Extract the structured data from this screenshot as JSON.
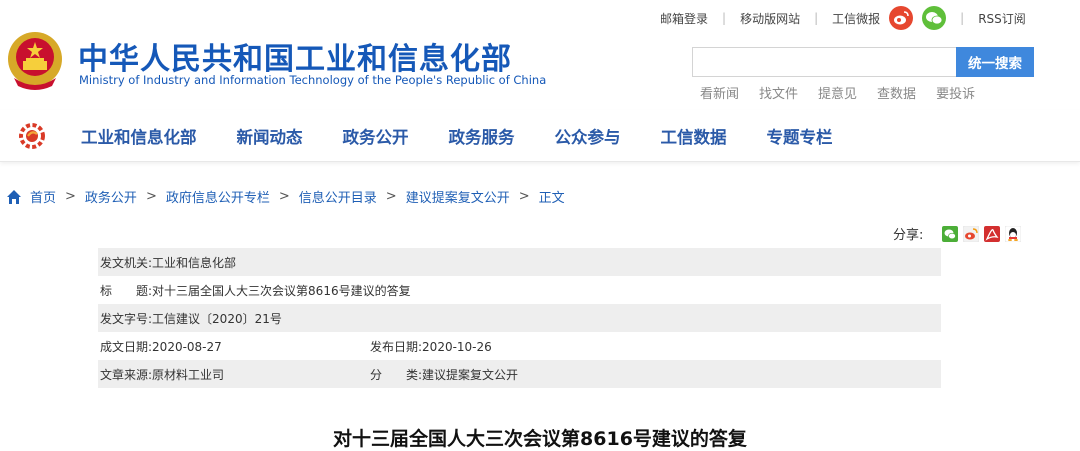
{
  "header": {
    "title": "中华人民共和国工业和信息化部",
    "subtitle": "Ministry of Industry and Information Technology of the People's Republic of China",
    "emblem_icon": "national-emblem-icon"
  },
  "toplinks": {
    "mail": "邮箱登录",
    "mobile": "移动版网站",
    "weibo": "工信微报",
    "rss": "RSS订阅"
  },
  "search": {
    "placeholder": "",
    "button": "统一搜索"
  },
  "quicklinks": [
    "看新闻",
    "找文件",
    "提意见",
    "查数据",
    "要投诉"
  ],
  "nav": {
    "items": [
      "工业和信息化部",
      "新闻动态",
      "政务公开",
      "政务服务",
      "公众参与",
      "工信数据",
      "专题专栏"
    ]
  },
  "breadcrumb": {
    "items": [
      "首页",
      "政务公开",
      "政府信息公开专栏",
      "信息公开目录",
      "建议提案复文公开",
      "正文"
    ],
    "separator": ">"
  },
  "share": {
    "label": "分享:",
    "icons": [
      "wechat-icon",
      "weibo-icon",
      "pdf-icon",
      "qq-icon"
    ]
  },
  "meta": {
    "issuer_label": "发文机关:",
    "issuer": "工业和信息化部",
    "title_label": "标　　题:",
    "title": "对十三届全国人大三次会议第8616号建议的答复",
    "doc_no_label": "发文字号:",
    "doc_no": "工信建议〔2020〕21号",
    "created_label": "成文日期:",
    "created": "2020-08-27",
    "published_label": "发布日期:",
    "published": "2020-10-26",
    "source_label": "文章来源:",
    "source": "原材料工业司",
    "category_label": "分　　类:",
    "category": "建议提案复文公开"
  },
  "article": {
    "title": "对十三届全国人大三次会议第8616号建议的答复"
  },
  "colors": {
    "brand_blue": "#1558b8",
    "nav_blue": "#2b5aa8",
    "search_button": "#3f88dd",
    "weibo_red": "#e6472f",
    "wechat_green": "#5fbf3a",
    "row_shade": "#eeeeee"
  }
}
